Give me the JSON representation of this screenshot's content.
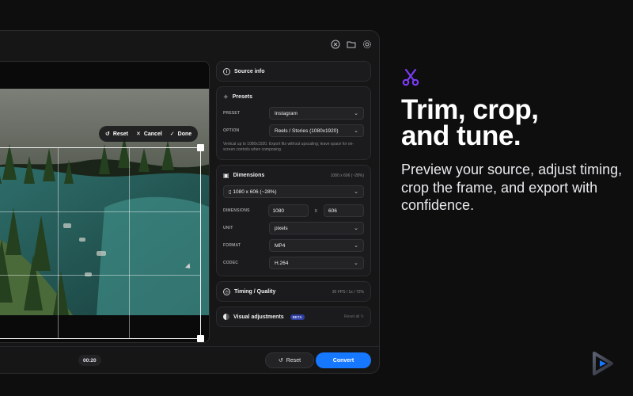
{
  "preview": {
    "crop_bar": {
      "reset": "Reset",
      "cancel": "Cancel",
      "done": "Done"
    },
    "time": "00:20"
  },
  "panel": {
    "source_info": {
      "title": "Source info"
    },
    "presets": {
      "title": "Presets",
      "preset_label": "PRESET",
      "preset_value": "Instagram",
      "option_label": "OPTION",
      "option_value": "Reels / Stories (1080x1920)",
      "hint": "Vertical up to 1080x1920. Export fits without upscaling; leave space for on-screen controls when composing."
    },
    "dimensions": {
      "title": "Dimensions",
      "meta": "1080 x 606 (~28%)",
      "size_select": "1080 x 606 (~28%)",
      "dimensions_label": "DIMENSIONS",
      "width": "1080",
      "times": "x",
      "height": "606",
      "unit_label": "UNIT",
      "unit_value": "pixels",
      "format_label": "FORMAT",
      "format_value": "MP4",
      "codec_label": "CODEC",
      "codec_value": "H.264"
    },
    "timing": {
      "title": "Timing / Quality",
      "meta": "30 FPS / 1x / 72%"
    },
    "visual": {
      "title": "Visual adjustments",
      "badge": "BETA",
      "reset_all": "Reset all"
    }
  },
  "bottom": {
    "reset": "Reset",
    "convert": "Convert"
  },
  "marketing": {
    "headline_line1": "Trim, crop,",
    "headline_line2": "and tune.",
    "subtext": "Preview your source, adjust timing, crop the frame, and export with confidence."
  },
  "colors": {
    "accent": "#1677ff",
    "scissors": "#7b3cf5",
    "background": "#0e0e0f"
  },
  "icons": [
    "close-circle-icon",
    "folder-icon",
    "gear-icon",
    "scissors-icon",
    "info-icon",
    "magic-wand-icon",
    "dimensions-icon",
    "clock-icon",
    "palette-icon",
    "reset-icon",
    "close-icon",
    "check-icon",
    "phone-icon",
    "play-logo-icon"
  ]
}
